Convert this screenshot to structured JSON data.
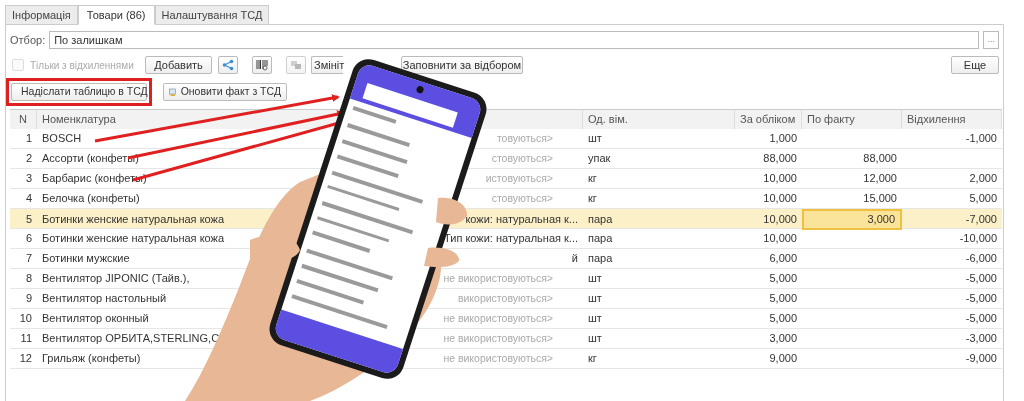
{
  "tabs": [
    {
      "label": "Інформація",
      "selected": false
    },
    {
      "label": "Товари (86)",
      "selected": true
    },
    {
      "label": "Налаштування ТСД",
      "selected": false
    }
  ],
  "filter": {
    "label": "Отбор:",
    "value": "По залишкам",
    "button": "..."
  },
  "only_deviations": {
    "label": "Тільки з відхиленнями",
    "checked": false,
    "disabled": true
  },
  "toolbar": [
    {
      "kind": "text",
      "label": "Добавить"
    },
    {
      "kind": "share"
    },
    {
      "kind": "barcode"
    },
    {
      "kind": "copy"
    },
    {
      "kind": "text",
      "label": "Змініт"
    },
    {
      "kind": "text",
      "label": "Заповнити за відбором"
    }
  ],
  "more_button": "Еще",
  "actions": [
    {
      "label": "Надіслати таблицю в ТСД",
      "highlighted": true
    },
    {
      "label": "Оновити факт з ТСД",
      "highlighted": false
    }
  ],
  "table": {
    "columns": [
      "N",
      "Номенклатура",
      "Од. вім.",
      "За обліком",
      "По факту",
      "Відхилення"
    ],
    "rows": [
      {
        "n": "1",
        "name": "BOSCH",
        "column_3": "товуються>",
        "column_3_unset": true,
        "unit": "шт",
        "book": "1,000",
        "fact": "",
        "deviation": "-1,000",
        "selected": false
      },
      {
        "n": "2",
        "name": "Ассорти (конфеты)",
        "column_3": "стовуються>",
        "column_3_unset": true,
        "unit": "упак",
        "book": "88,000",
        "fact": "88,000",
        "deviation": "",
        "selected": false
      },
      {
        "n": "3",
        "name": "Барбарис (конфеты)",
        "column_3": "истовуються>",
        "column_3_unset": true,
        "unit": "кг",
        "book": "10,000",
        "fact": "12,000",
        "deviation": "2,000",
        "selected": false
      },
      {
        "n": "4",
        "name": "Белочка (конфеты)",
        "column_3": "стовуються>",
        "column_3_unset": true,
        "unit": "кг",
        "book": "10,000",
        "fact": "15,000",
        "deviation": "5,000",
        "selected": false
      },
      {
        "n": "5",
        "name": "Ботинки женские натуральная кожа",
        "column_3": "кожи: натуральная к...",
        "column_3_unset": false,
        "unit": "пара",
        "book": "10,000",
        "fact": "3,000",
        "deviation": "-7,000",
        "selected": true
      },
      {
        "n": "6",
        "name": "Ботинки женские натуральная кожа",
        "column_3": "Тип кожи: натуральная к...",
        "column_3_unset": false,
        "unit": "пара",
        "book": "10,000",
        "fact": "",
        "deviation": "-10,000",
        "selected": false
      },
      {
        "n": "7",
        "name": "Ботинки мужские",
        "column_3": "й",
        "column_3_unset": false,
        "unit": "пара",
        "book": "6,000",
        "fact": "",
        "deviation": "-6,000",
        "selected": false
      },
      {
        "n": "8",
        "name": "Вентилятор JIPONIC (Тайв.),",
        "column_3": "не використовуються>",
        "column_3_unset": true,
        "unit": "шт",
        "book": "5,000",
        "fact": "",
        "deviation": "-5,000",
        "selected": false
      },
      {
        "n": "9",
        "name": "Вентилятор настольный",
        "column_3": "використовуються>",
        "column_3_unset": true,
        "unit": "шт",
        "book": "5,000",
        "fact": "",
        "deviation": "-5,000",
        "selected": false
      },
      {
        "n": "10",
        "name": "Вентилятор оконный",
        "column_3": "не використовуються>",
        "column_3_unset": true,
        "unit": "шт",
        "book": "5,000",
        "fact": "",
        "deviation": "-5,000",
        "selected": false
      },
      {
        "n": "11",
        "name": "Вентилятор ОРБИТА,STERLING,С",
        "column_3": "не використовуються>",
        "column_3_unset": true,
        "unit": "шт",
        "book": "3,000",
        "fact": "",
        "deviation": "-3,000",
        "selected": false
      },
      {
        "n": "12",
        "name": "Грильяж (конфеты)",
        "column_3": "не використовуються>",
        "column_3_unset": true,
        "unit": "кг",
        "book": "9,000",
        "fact": "",
        "deviation": "-9,000",
        "selected": false
      }
    ]
  }
}
